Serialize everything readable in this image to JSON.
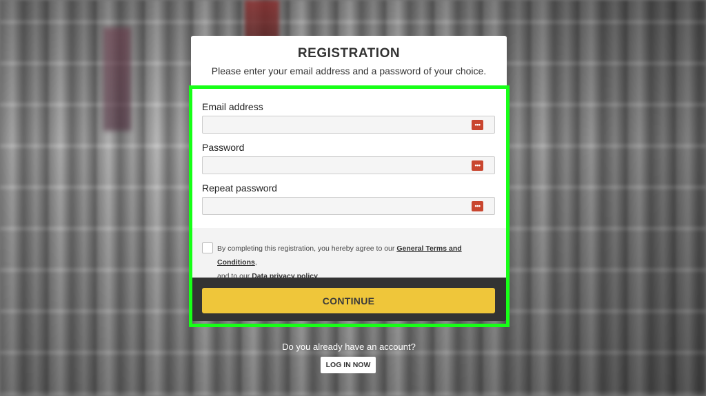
{
  "header": {
    "title": "REGISTRATION",
    "subtitle": "Please enter your email address and a password of your choice."
  },
  "form": {
    "email": {
      "label": "Email address",
      "value": "",
      "icon": "password-manager-icon"
    },
    "password": {
      "label": "Password",
      "value": "",
      "icon": "password-manager-icon"
    },
    "repeat_password": {
      "label": "Repeat password",
      "value": "",
      "icon": "password-manager-icon"
    }
  },
  "terms": {
    "checked": false,
    "text_before": "By completing this registration, you hereby agree to our ",
    "terms_link": "General Terms and Conditions",
    "text_middle": ",",
    "text_line2": "and to our ",
    "privacy_link": "Data privacy policy",
    "text_end": "."
  },
  "actions": {
    "continue_label": "CONTINUE"
  },
  "login": {
    "prompt": "Do you already have an account?",
    "button_label": "LOG IN NOW"
  },
  "colors": {
    "accent": "#efc63a",
    "dark_bar": "#333333",
    "icon_red": "#c9462f",
    "highlight": "#17ff17"
  }
}
